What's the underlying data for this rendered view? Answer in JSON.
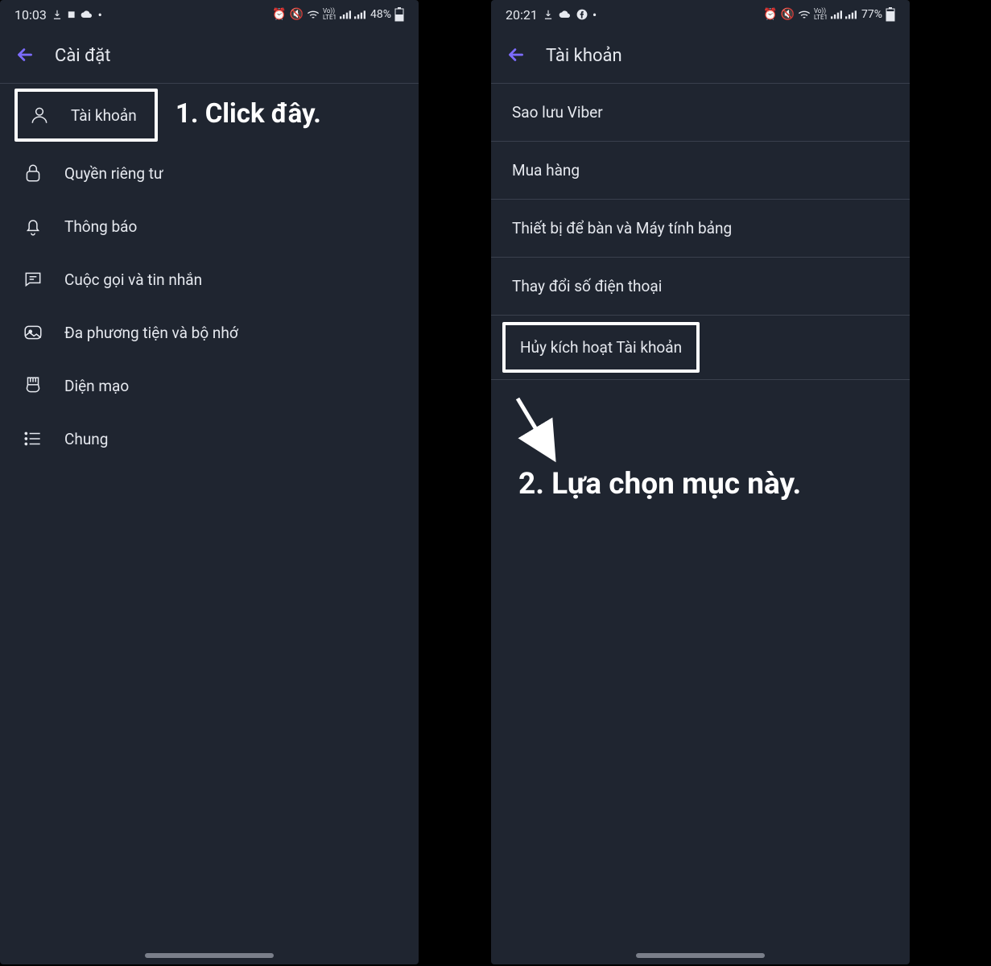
{
  "left": {
    "status": {
      "time": "10:03",
      "battery": "48%"
    },
    "header": {
      "title": "Cài đặt"
    },
    "items": [
      {
        "label": "Tài khoản"
      },
      {
        "label": "Quyền riêng tư"
      },
      {
        "label": "Thông báo"
      },
      {
        "label": "Cuộc gọi và tin nhắn"
      },
      {
        "label": "Đa phương tiện và bộ nhớ"
      },
      {
        "label": "Diện mạo"
      },
      {
        "label": "Chung"
      }
    ],
    "annotation": "1. Click đây."
  },
  "right": {
    "status": {
      "time": "20:21",
      "battery": "77%"
    },
    "header": {
      "title": "Tài khoản"
    },
    "items": [
      {
        "label": "Sao lưu Viber"
      },
      {
        "label": "Mua hàng"
      },
      {
        "label": "Thiết bị để bàn và Máy tính bảng"
      },
      {
        "label": "Thay đổi số điện thoại"
      },
      {
        "label": "Hủy kích hoạt Tài khoản"
      }
    ],
    "annotation": "2. Lựa chọn mục này."
  }
}
